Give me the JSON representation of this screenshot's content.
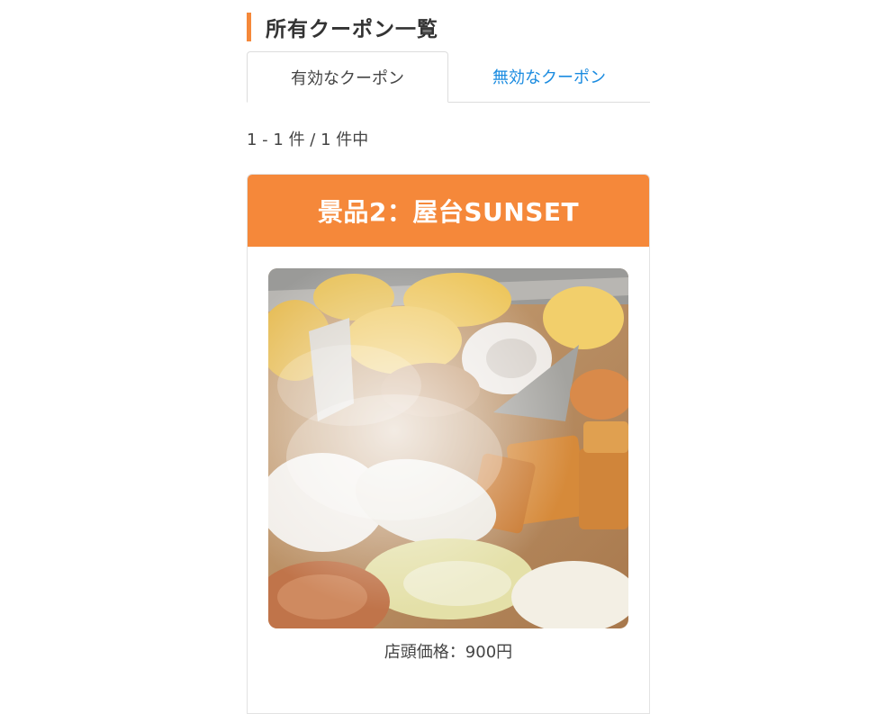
{
  "page": {
    "title": "所有クーポン一覧"
  },
  "tabs": {
    "active_label": "有効なクーポン",
    "inactive_label": "無効なクーポン"
  },
  "results": {
    "count_text": "1 - 1 件 / 1 件中"
  },
  "coupon": {
    "title": "景品2：屋台SUNSET",
    "photo_subject": "oden",
    "price_text": "店頭価格：900円"
  },
  "colors": {
    "accent": "#f5883a",
    "link": "#1a8be0"
  }
}
